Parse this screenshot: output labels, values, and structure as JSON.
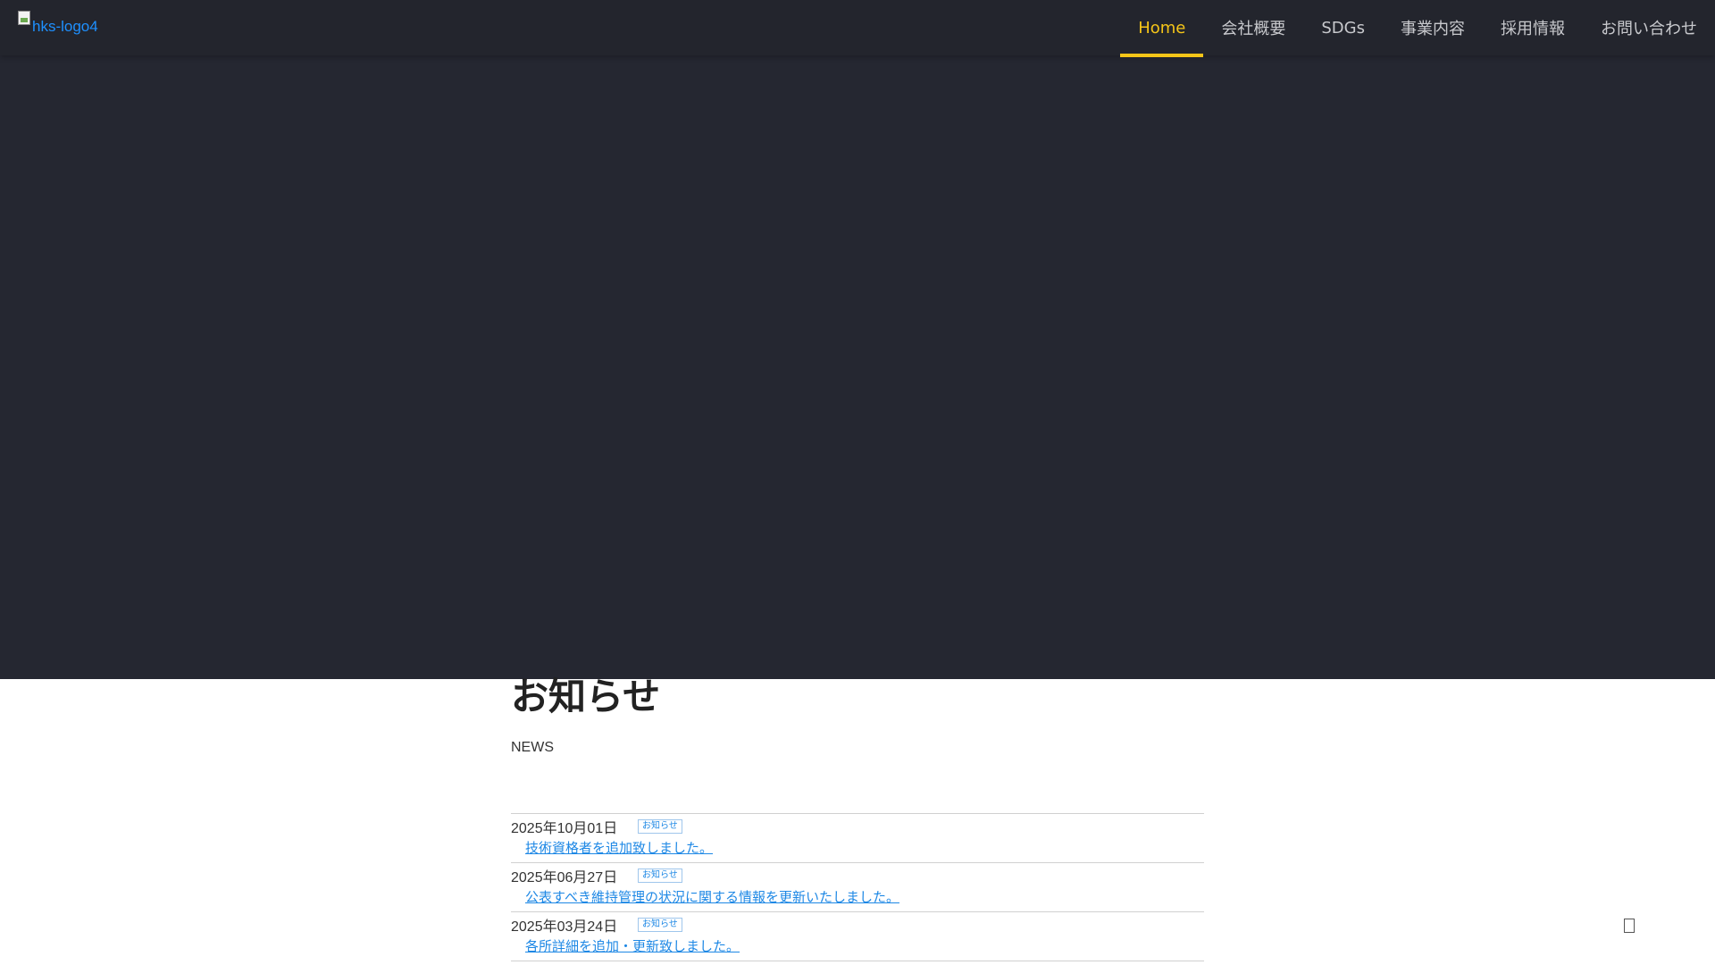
{
  "header": {
    "logo_alt": "hks-logo4",
    "nav": [
      {
        "label": "Home",
        "active": true
      },
      {
        "label": "会社概要"
      },
      {
        "label": "SDGs"
      },
      {
        "label": "事業内容"
      },
      {
        "label": "採用情報"
      },
      {
        "label": "お問い合わせ"
      }
    ]
  },
  "news": {
    "title": "お知らせ",
    "subtitle": "NEWS",
    "items": [
      {
        "date": "2025年10月01日",
        "badge": "お知らせ",
        "text": "技術資格者を追加致しました。"
      },
      {
        "date": "2025年06月27日",
        "badge": "お知らせ",
        "text": "公表すべき維持管理の状況に関する情報を更新いたしました。"
      },
      {
        "date": "2025年03月24日",
        "badge": "お知らせ",
        "text": "各所詳細を追加・更新致しました。"
      }
    ]
  },
  "colors": {
    "header_bg": "#23252d",
    "hero_bg": "#252731",
    "accent": "#f5c518",
    "link": "#1e88e5"
  },
  "icons": {
    "scroll_top": "scroll-top-icon"
  }
}
